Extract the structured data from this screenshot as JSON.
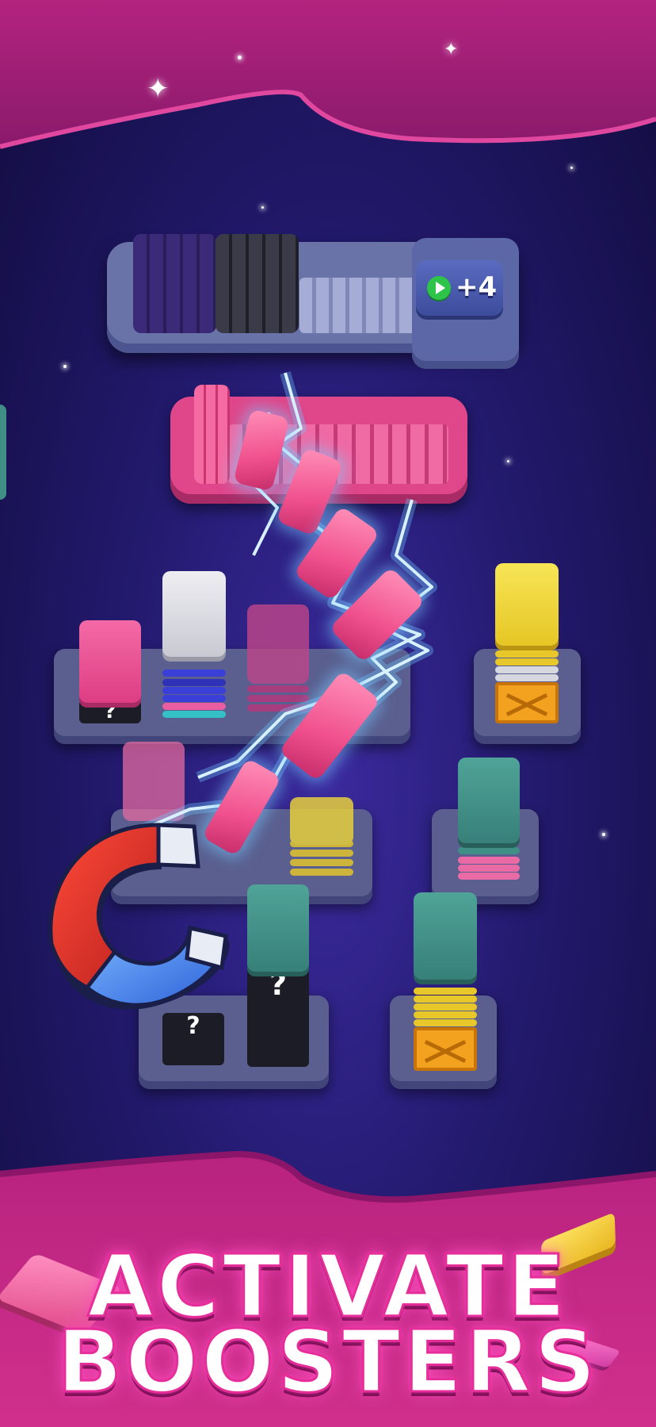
{
  "slot_bar": {
    "ad_icon": "play-icon",
    "ad_label": "+4"
  },
  "banner": {
    "line1": "ACTIVATE",
    "line2": "BOOSTERS"
  },
  "booster": {
    "icon": "magnet-icon"
  },
  "mystery_mark": "?",
  "colors": {
    "background": "#231a6e",
    "banner": "#c2208a",
    "pink_tile": "#f0508d",
    "yellow_tile": "#f4dc3a",
    "teal_tile": "#3f8f86",
    "lightning": "#8fd6ff"
  }
}
